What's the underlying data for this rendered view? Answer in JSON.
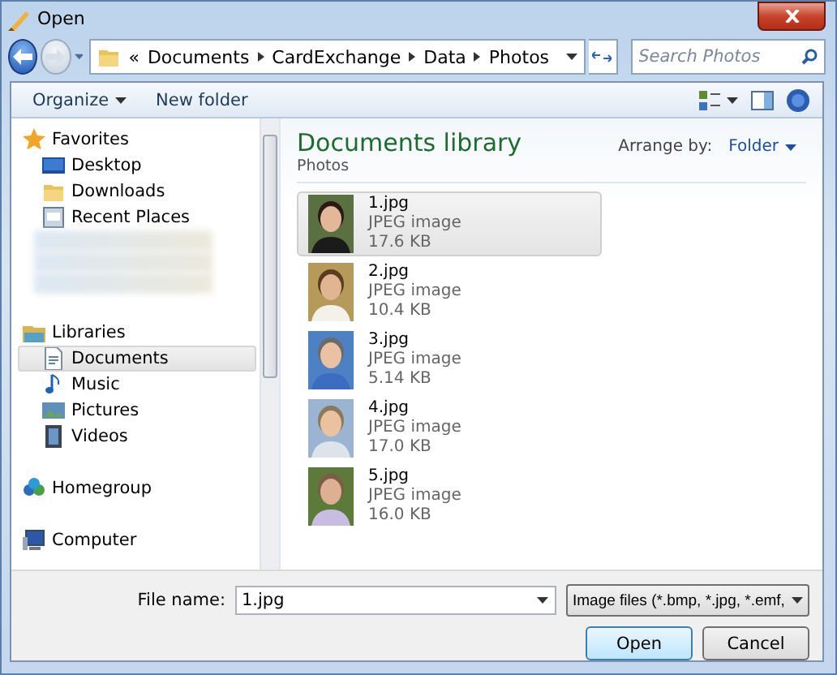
{
  "window": {
    "title": "Open"
  },
  "navigation": {
    "back_enabled": true,
    "forward_enabled": false
  },
  "breadcrumb": {
    "overflow": "«",
    "segments": [
      "Documents",
      "CardExchange",
      "Data",
      "Photos"
    ]
  },
  "search": {
    "placeholder": "Search Photos"
  },
  "toolbar": [
    {
      "label": "Organize",
      "kind": "menu"
    },
    {
      "label": "New folder",
      "kind": "plain"
    }
  ],
  "nav_pane": [
    {
      "label": "Favorites",
      "kind": "star",
      "children": [
        {
          "label": "Desktop",
          "kind": "desktop",
          "selected": false
        },
        {
          "label": "Downloads",
          "kind": "folder",
          "selected": false
        },
        {
          "label": "Recent Places",
          "kind": "recent",
          "selected": false
        },
        {
          "kind": "blurred"
        },
        {
          "kind": "blurred"
        },
        {
          "kind": "blurred"
        }
      ]
    },
    {
      "label": "Libraries",
      "kind": "library",
      "children": [
        {
          "label": "Documents",
          "kind": "document",
          "selected": true
        },
        {
          "label": "Music",
          "kind": "music",
          "selected": false
        },
        {
          "label": "Pictures",
          "kind": "pictures",
          "selected": false
        },
        {
          "label": "Videos",
          "kind": "videos",
          "selected": false
        }
      ]
    },
    {
      "label": "Homegroup",
      "kind": "homegroup"
    },
    {
      "label": "Computer",
      "kind": "computer"
    }
  ],
  "library": {
    "title": "Documents library",
    "subtitle": "Photos",
    "arrange_label": "Arrange by:",
    "arrange_value": "Folder"
  },
  "files": [
    {
      "name": "1.jpg",
      "type": "JPEG image",
      "size": "17.6 KB",
      "selected": true
    },
    {
      "name": "2.jpg",
      "type": "JPEG image",
      "size": "10.4 KB",
      "selected": false
    },
    {
      "name": "3.jpg",
      "type": "JPEG image",
      "size": "5.14 KB",
      "selected": false
    },
    {
      "name": "4.jpg",
      "type": "JPEG image",
      "size": "17.0 KB",
      "selected": false
    },
    {
      "name": "5.jpg",
      "type": "JPEG image",
      "size": "16.0 KB",
      "selected": false
    }
  ],
  "footer": {
    "file_name_label": "File name:",
    "file_name_value": "1.jpg",
    "filter": "Image files (*.bmp, *.jpg, *.emf,",
    "buttons": [
      {
        "label": "Open",
        "default": true
      },
      {
        "label": "Cancel",
        "default": false
      }
    ]
  }
}
